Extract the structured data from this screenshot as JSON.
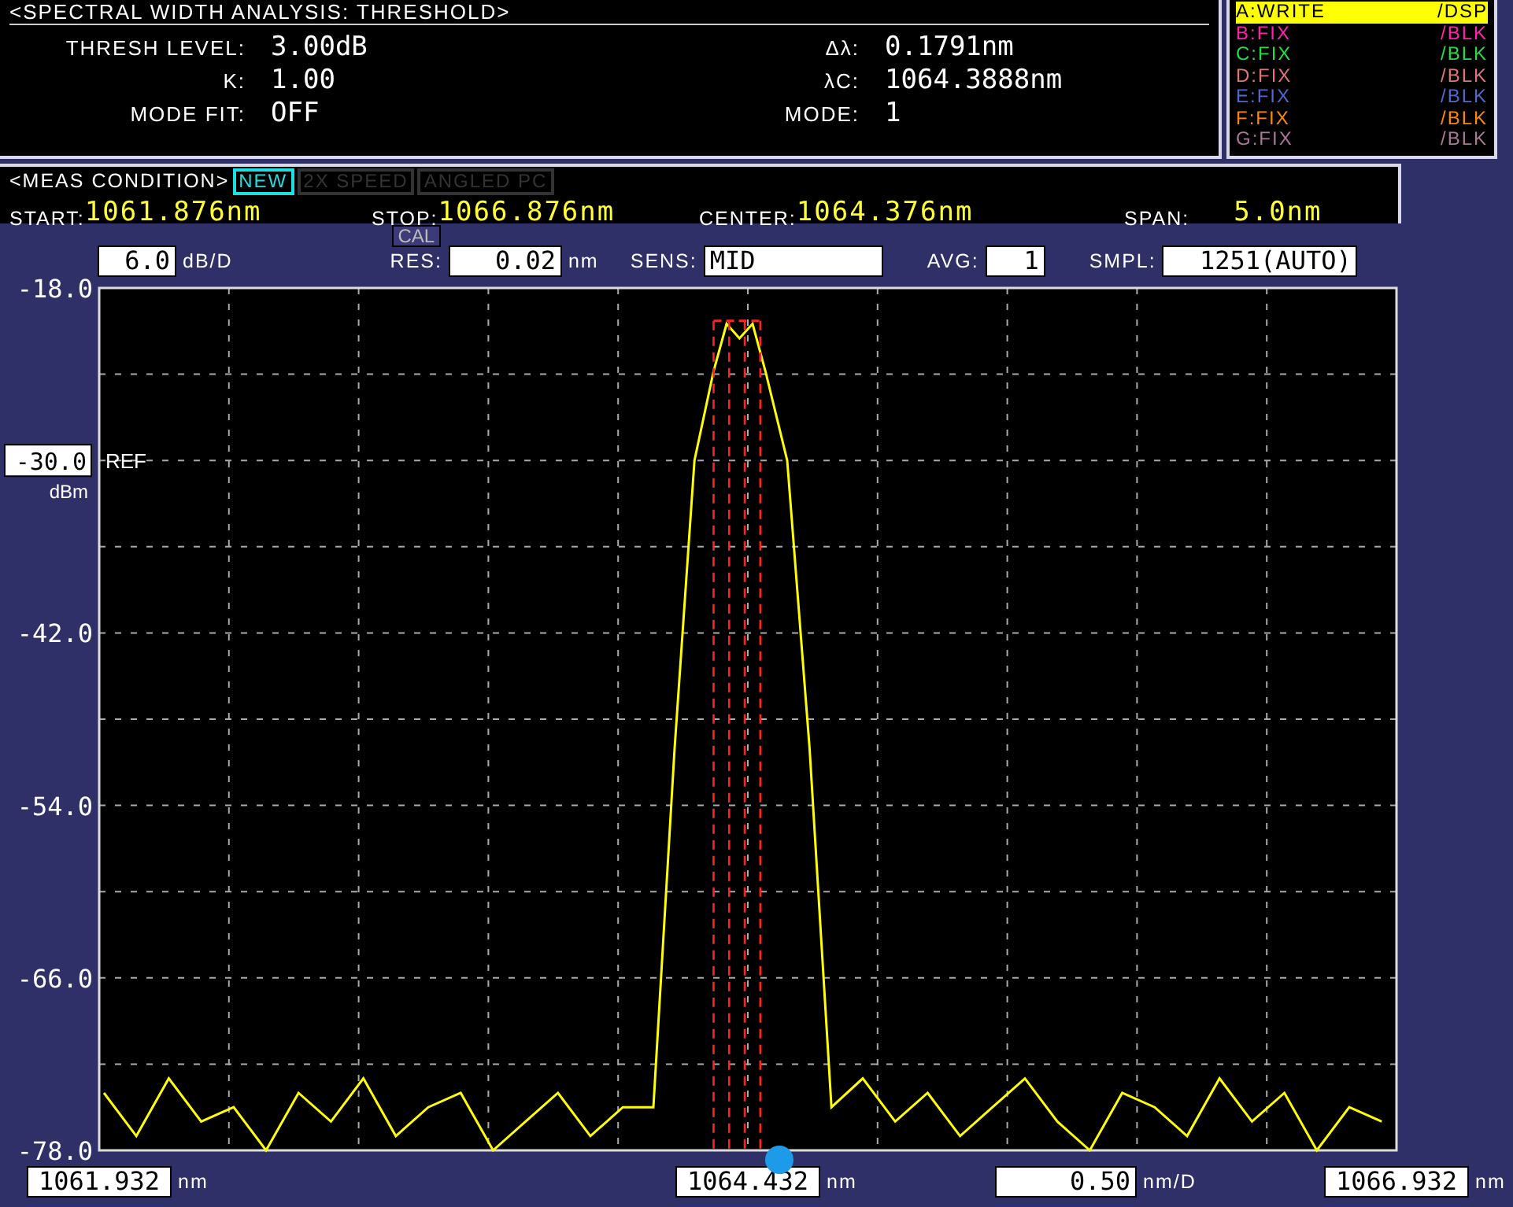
{
  "analysis": {
    "title": "<SPECTRAL WIDTH ANALYSIS: THRESHOLD>",
    "left_params": [
      {
        "label": "THRESH LEVEL:",
        "value": "3.00dB"
      },
      {
        "label": "K:",
        "value": "1.00"
      },
      {
        "label": "MODE FIT:",
        "value": "OFF"
      }
    ],
    "right_params": [
      {
        "label": "Δλ:",
        "value": "0.1791nm"
      },
      {
        "label": "λC:",
        "value": "1064.3888nm"
      },
      {
        "label": "MODE:",
        "value": "1"
      }
    ]
  },
  "traces": [
    {
      "label": "A:WRITE",
      "mode": "/DSP",
      "color": "#ffff00",
      "selected": true
    },
    {
      "label": "B:FIX",
      "mode": "/BLK",
      "color": "#ff22aa",
      "selected": false
    },
    {
      "label": "C:FIX",
      "mode": "/BLK",
      "color": "#22dd44",
      "selected": false
    },
    {
      "label": "D:FIX",
      "mode": "/BLK",
      "color": "#dd7777",
      "selected": false
    },
    {
      "label": "E:FIX",
      "mode": "/BLK",
      "color": "#5566cc",
      "selected": false
    },
    {
      "label": "F:FIX",
      "mode": "/BLK",
      "color": "#ff8800",
      "selected": false
    },
    {
      "label": "G:FIX",
      "mode": "/BLK",
      "color": "#aa7799",
      "selected": false
    }
  ],
  "meas_condition": {
    "title": "<MEAS CONDITION>",
    "flags": [
      {
        "label": "NEW",
        "on": true
      },
      {
        "label": "2X SPEED",
        "on": false
      },
      {
        "label": "ANGLED PC",
        "on": false
      }
    ],
    "items": [
      {
        "label": "START:",
        "value": "1061.876nm"
      },
      {
        "label": "STOP:",
        "value": "1066.876nm"
      },
      {
        "label": "CENTER:",
        "value": "1064.376nm"
      },
      {
        "label": "SPAN:",
        "value": "5.0nm"
      }
    ]
  },
  "settings": {
    "scale": "6.0",
    "scale_unit": "dB/D",
    "cal": "CAL",
    "res_label": "RES:",
    "res": "0.02",
    "res_unit": "nm",
    "sens_label": "SENS:",
    "sens": "MID",
    "avg_label": "AVG:",
    "avg": "1",
    "smpl_label": "SMPL:",
    "smpl": "1251(AUTO)"
  },
  "ref": {
    "value": "-30.0",
    "label": "REF",
    "unit": "dBm"
  },
  "chart_data": {
    "type": "line",
    "xlim": [
      1061.932,
      1066.932
    ],
    "ylim": [
      -78,
      -18
    ],
    "yticks": [
      {
        "value": -18,
        "label": "-18.0"
      },
      {
        "value": -42,
        "label": "-42.0"
      },
      {
        "value": -54,
        "label": "-54.0"
      },
      {
        "value": -66,
        "label": "-66.0"
      },
      {
        "value": -78,
        "label": "-78.0"
      }
    ],
    "x": [
      1061.95,
      1062.075,
      1062.2,
      1062.325,
      1062.45,
      1062.575,
      1062.7,
      1062.825,
      1062.95,
      1063.075,
      1063.2,
      1063.325,
      1063.45,
      1063.575,
      1063.7,
      1063.825,
      1063.95,
      1064.068,
      1064.15,
      1064.226,
      1064.3,
      1064.35,
      1064.4,
      1064.45,
      1064.5,
      1064.584,
      1064.67,
      1064.754,
      1064.875,
      1065.0,
      1065.125,
      1065.25,
      1065.375,
      1065.5,
      1065.625,
      1065.75,
      1065.875,
      1066.0,
      1066.125,
      1066.25,
      1066.375,
      1066.5,
      1066.625,
      1066.75,
      1066.875
    ],
    "xticks": [
      {
        "value": 1061.932,
        "label": "1061.932"
      },
      {
        "value": 1064.432,
        "label": "1064.432"
      },
      {
        "value": 1066.932,
        "label": "1066.932"
      }
    ],
    "series": [
      {
        "color": "#ffff00",
        "values": [
          -74,
          -77,
          -73,
          -76,
          -75,
          -78,
          -74,
          -76,
          -73,
          -77,
          -75,
          -74,
          -78,
          -76,
          -74,
          -77,
          -75,
          -75,
          -50,
          -30,
          -23.8,
          -20.5,
          -21.5,
          -20.5,
          -23.8,
          -30,
          -50,
          -75,
          -73,
          -76,
          -74,
          -77,
          -75,
          -73,
          -76,
          -78,
          -74,
          -75,
          -77,
          -73,
          -76,
          -74,
          -78,
          -75,
          -76
        ]
      }
    ],
    "grid": true,
    "ref_lines": [
      {
        "axis": "x",
        "value": 1064.3
      },
      {
        "axis": "x",
        "value": 1064.36
      },
      {
        "axis": "x",
        "value": 1064.42
      },
      {
        "axis": "x",
        "value": 1064.48
      }
    ]
  },
  "x_axis": {
    "start_unit": "nm",
    "center_unit": "nm",
    "per_div": "0.50",
    "per_div_unit": "nm/D",
    "stop_unit": "nm"
  }
}
